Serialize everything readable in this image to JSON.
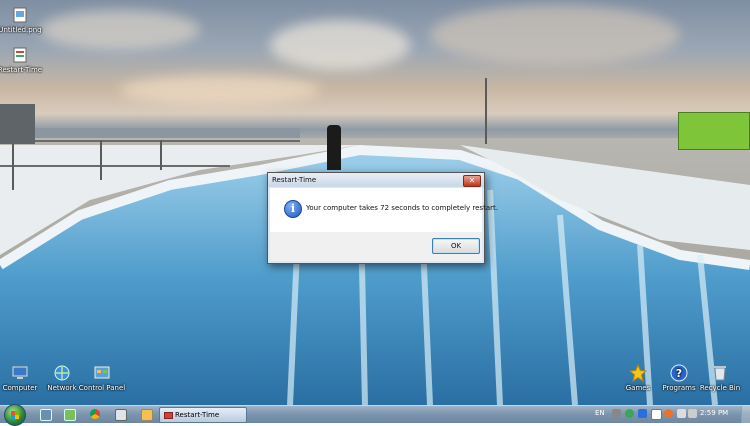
{
  "desktop": {
    "icons_left_top": [
      {
        "label": "Untitled.png",
        "icon": "image-file-icon"
      },
      {
        "label": "Restart-Time",
        "icon": "script-file-icon"
      }
    ],
    "icons_bottom_left": [
      {
        "label": "Computer",
        "icon": "computer-icon"
      },
      {
        "label": "Network",
        "icon": "network-icon"
      },
      {
        "label": "Control Panel",
        "icon": "control-panel-icon"
      }
    ],
    "icons_bottom_right": [
      {
        "label": "Games",
        "icon": "games-star-icon"
      },
      {
        "label": "Programs",
        "icon": "help-programs-icon"
      },
      {
        "label": "Recycle Bin",
        "icon": "recycle-bin-icon"
      }
    ]
  },
  "dialog": {
    "title": "Restart-Time",
    "close_glyph": "✕",
    "message": "Your computer takes 72 seconds to completely restart.",
    "ok_label": "OK",
    "icon": "information-icon"
  },
  "taskbar": {
    "active_window_label": "Restart-Time",
    "language": "EN",
    "clock": "2:59 PM"
  },
  "colors": {
    "taskbar": "#7d95ae",
    "dialog_close": "#c2351b",
    "info_blue": "#1f58c0"
  }
}
